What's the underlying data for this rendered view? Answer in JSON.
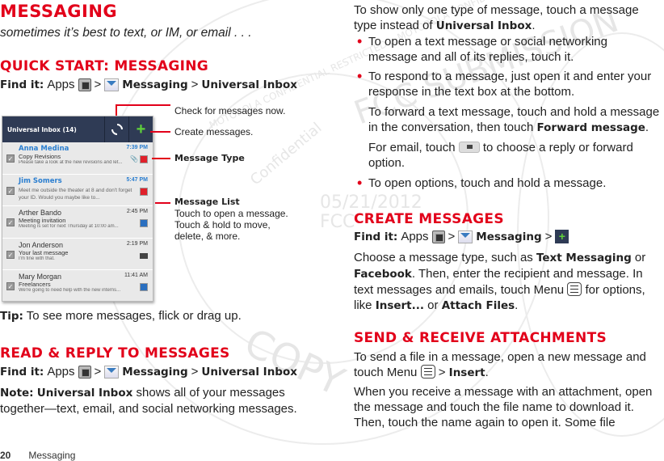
{
  "watermark": {
    "date": "05/21/2012",
    "agency": "FCC",
    "words": [
      "MOTOROLA CONFIDENTIAL RESTRICTED :: MOTOROLA CONFIDENTIAL",
      "FCC SUBMISSION",
      "COPY",
      "Confidential"
    ]
  },
  "left": {
    "title": "MESSAGING",
    "subtitle": "sometimes it’s best to text, or IM, or email . . .",
    "quick_start": {
      "heading": "QUICK START: MESSAGING",
      "find_it_label": "Find it:",
      "apps": "Apps",
      "sep": ">",
      "messaging": "Messaging",
      "inbox": "Universal Inbox"
    },
    "phone": {
      "title": "Universal Inbox (14)",
      "messages": [
        {
          "name": "Anna Medina",
          "time": "7:39 PM",
          "subject": "Copy Revisions",
          "preview": "Please take a look at the new revisions and let...",
          "unread": true,
          "type": "social",
          "attachment": true
        },
        {
          "name": "Jim Somers",
          "time": "5:47 PM",
          "subject": "",
          "preview": "Meet me outside the theater at 8 and don't forget your ID. Would you maybe like to...",
          "unread": true,
          "type": "social",
          "attachment": false
        },
        {
          "name": "Arther Bando",
          "time": "2:45 PM",
          "subject": "Meeting invitation",
          "preview": "Meeting is set for next Thursday at 10:00 am...",
          "unread": false,
          "type": "event",
          "attachment": false
        },
        {
          "name": "Jon Anderson",
          "time": "2:19 PM",
          "subject": "Your last message",
          "preview": "I'm fine with that.",
          "unread": false,
          "type": "email",
          "attachment": false
        },
        {
          "name": "Mary Morgan",
          "time": "11:41 AM",
          "subject": "Freelancers",
          "preview": "We're going to need help with the new interns...",
          "unread": false,
          "type": "event",
          "attachment": false
        }
      ]
    },
    "callouts": {
      "check": "Check for messages now.",
      "create": "Create messages.",
      "type": "Message Type",
      "list_title": "Message List",
      "list_line1": "Touch to open a message.",
      "list_line2": "Touch & hold to move,",
      "list_line3": "delete, & more."
    },
    "tip_label": "Tip:",
    "tip_text": " To see more messages, flick or drag up.",
    "read_reply": {
      "heading": "READ & REPLY TO MESSAGES",
      "find_it_label": "Find it:",
      "apps": "Apps",
      "sep": ">",
      "messaging": "Messaging",
      "inbox": "Universal Inbox",
      "note_label": "Note:",
      "note_bold": "Universal Inbox",
      "note_line1": " shows all of your messages",
      "note_line2": "together—text, email, and social networking messages."
    }
  },
  "right": {
    "intro_1": "To show only one type of message, touch a message",
    "intro_2": "type instead of ",
    "intro_bold": "Universal Inbox",
    "intro_end": ".",
    "bullets": [
      {
        "l1": "To open a text message or social networking",
        "l2": "message and all of its replies, touch it."
      },
      {
        "l1": "To respond to a message, just open it and enter your",
        "l2": "response in the text box at the bottom."
      }
    ],
    "forward_1": "To forward a text message, touch and hold a message",
    "forward_2": "in the conversation, then touch ",
    "forward_bold": "Forward message",
    "forward_end": ".",
    "email_1": "For email, touch ",
    "email_2": " to choose a reply or forward",
    "email_3": "option.",
    "bullet3": "To open options, touch and hold a message.",
    "create": {
      "heading": "CREATE MESSAGES",
      "find_it_label": "Find it:",
      "apps": "Apps",
      "sep": ">",
      "messaging": "Messaging",
      "l1a": "Choose a message type, such as ",
      "l1b": "Text Messaging",
      "l1c": " or",
      "l2a": "Facebook",
      "l2b": ". Then, enter the recipient and message. In",
      "l3a": "text messages and emails, touch Menu ",
      "l3b": " for options,",
      "l4a": "like ",
      "l4b": "Insert...",
      "l4c": " or ",
      "l4d": "Attach Files",
      "l4e": "."
    },
    "attach": {
      "heading": "SEND & RECEIVE ATTACHMENTS",
      "l1": "To send a file in a message, open a new message and",
      "l2a": "touch Menu ",
      "l2b": " > ",
      "l2c": "Insert",
      "l2d": ".",
      "l3": "When you receive a message with an attachment, open",
      "l4": "the message and touch the file name to download it.",
      "l5": "Then, touch the name again to open it. Some file"
    }
  },
  "footer": {
    "page_number": "20",
    "section": "Messaging"
  }
}
